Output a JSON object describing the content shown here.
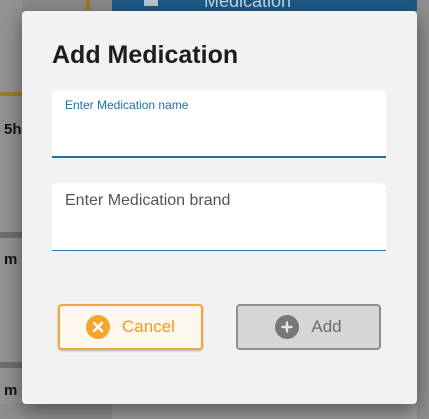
{
  "background": {
    "top_nav_text": "Medication",
    "left_letters": [
      "5h",
      "m",
      "m"
    ]
  },
  "dialog": {
    "title": "Add Medication",
    "name_field": {
      "label": "Enter Medication name",
      "value": ""
    },
    "brand_field": {
      "placeholder": "Enter Medication brand",
      "value": ""
    },
    "cancel_button": {
      "label": "Cancel",
      "icon": "close-circle-icon",
      "color": "#f29a1f"
    },
    "add_button": {
      "label": "Add",
      "icon": "plus-circle-icon",
      "disabled": true,
      "color": "#6c6c6c"
    }
  },
  "colors": {
    "accent_blue": "#1a73a8",
    "accent_orange": "#f3a63a"
  }
}
